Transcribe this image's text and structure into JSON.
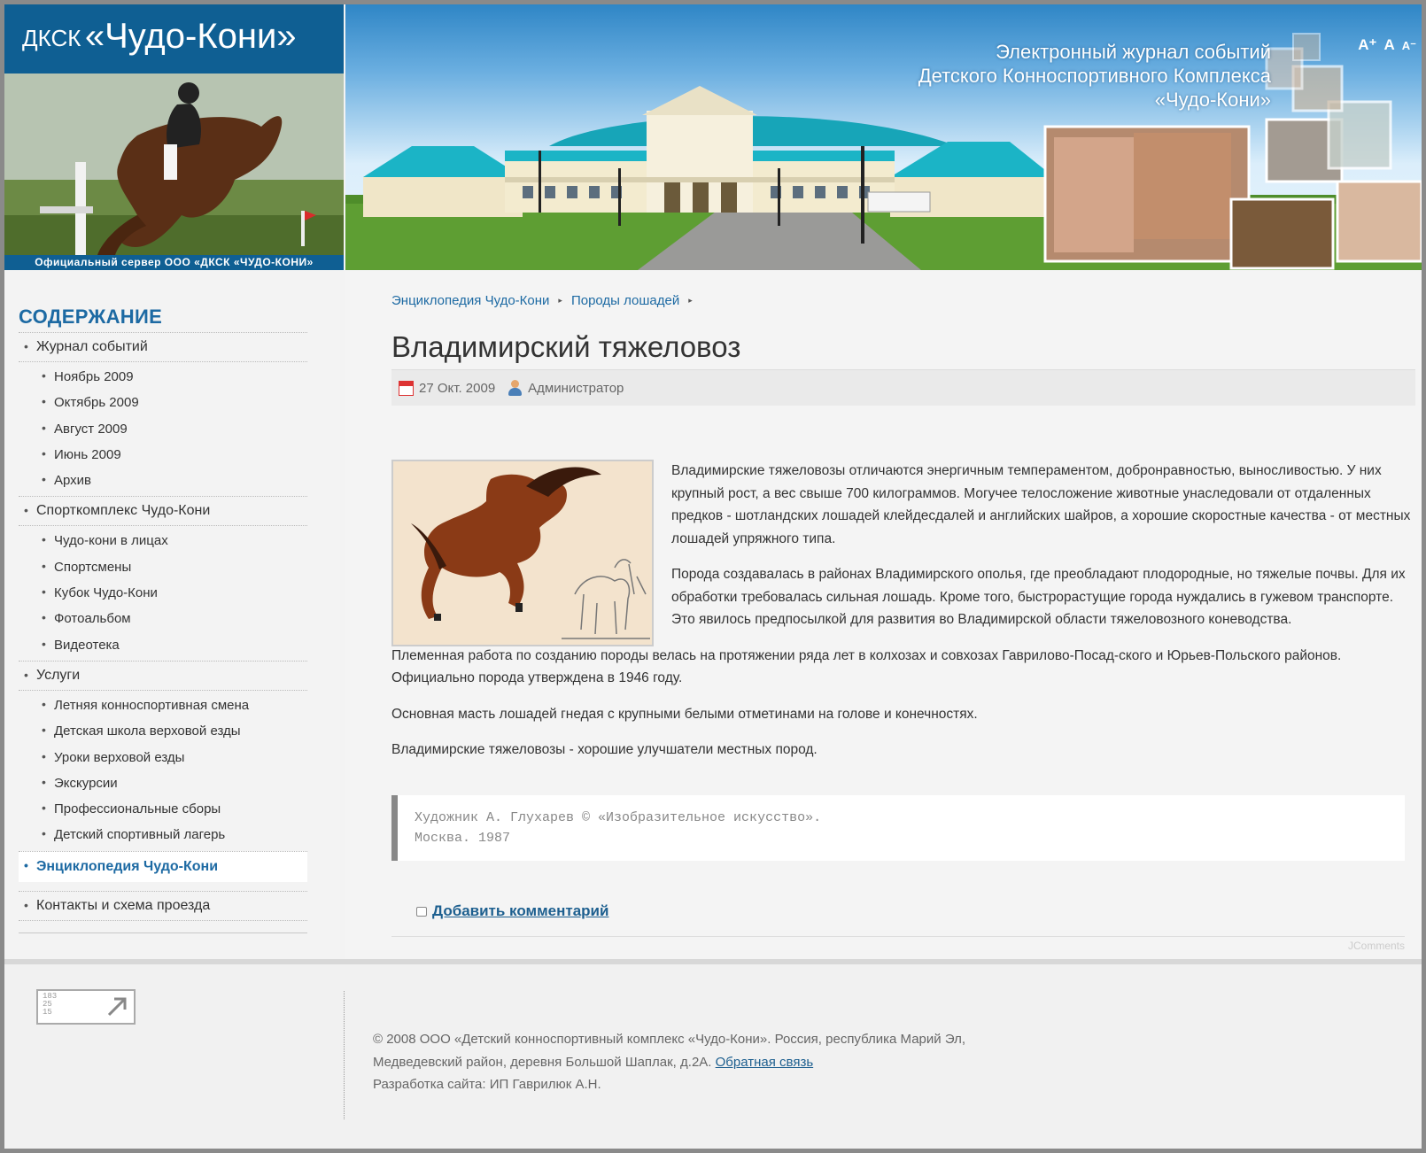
{
  "header": {
    "logo_small": "ДКСК",
    "logo_big": "«Чудо-Кони»",
    "logo_caption": "Официальный сервер ООО «ДКСК «ЧУДО-КОНИ»",
    "banner_title_line1": "Электронный журнал событий",
    "banner_title_line2": "Детского Конноспортивного Комплекса",
    "banner_title_line3": "«Чудо-Кони»",
    "font_controls": {
      "increase": "A⁺",
      "reset": "A",
      "decrease": "A⁻"
    }
  },
  "sidebar": {
    "title": "СОДЕРЖАНИЕ",
    "menu": [
      {
        "label": "Журнал событий",
        "children": [
          "Ноябрь 2009",
          "Октябрь 2009",
          "Август 2009",
          "Июнь 2009",
          "Архив"
        ]
      },
      {
        "label": "Спорткомплекс Чудо-Кони",
        "children": [
          "Чудо-кони в лицах",
          "Спортсмены",
          "Кубок Чудо-Кони",
          "Фотоальбом",
          "Видеотека"
        ]
      },
      {
        "label": "Услуги",
        "children": [
          "Летняя конноспортивная смена",
          "Детская школа верховой езды",
          "Уроки верховой езды",
          "Экскурсии",
          "Профессиональные сборы",
          "Детский спортивный лагерь"
        ]
      },
      {
        "label": "Энциклопедия Чудо-Кони",
        "active": true
      },
      {
        "label": "Контакты и схема проезда"
      }
    ]
  },
  "breadcrumb": [
    "Энциклопедия Чудо-Кони",
    "Породы лошадей"
  ],
  "article": {
    "title": "Владимирский тяжеловоз",
    "date": "27 Окт. 2009",
    "author": "Администратор",
    "paragraphs": [
      "Владимирские тяжеловозы отличаются энергичным темпераментом, добронравностью, выносливостью. У них крупный рост, а вес свыше 700 килограммов. Могучее телосложение животные унаследовали от отдаленных предков - шотландских лошадей клейдесдалей и английских шайров, а хорошие скоростные качества - от местных лошадей упряжного типа.",
      "Порода создавалась в районах Владимирского ополья, где преобладают плодородные, но тяжелые почвы. Для их обработки требовалась сильная лошадь. Кроме того, быстрорастущие города нуждались в гужевом транспорте. Это явилось предпосылкой для развития во Владимирской области тяжеловозного коневодства.",
      "Племенная работа по созданию породы велась на протяжении ряда лет в колхозах и совхозах Гаврилово-Посад-ского и Юрьев-Польского районов. Официально порода утверждена в 1946 году.",
      "Основная масть лошадей гнедая с крупными белыми отметинами на голове и конечностях.",
      "Владимирские тяжеловозы - хорошие улучшатели местных пород."
    ],
    "quote_line1": "Художник А. Глухарев © «Изобразительное искусство».",
    "quote_line2": "Москва. 1987",
    "add_comment": "Добавить комментарий",
    "jcomments": "JComments"
  },
  "footer": {
    "counter_nums": [
      "183",
      "25",
      "15"
    ],
    "line1": "© 2008 ООО «Детский конноспортивный комплекс «Чудо-Кони». Россия, республика Марий Эл,",
    "line2": "Медведевский район, деревня Большой Шаплак, д.2А.",
    "feedback_link": "Обратная связь",
    "line3": "Разработка сайта: ИП Гаврилюк А.Н."
  },
  "colors": {
    "brand_blue": "#0f5f93",
    "link_blue": "#1d6aa3",
    "page_bg": "#f3f3f3"
  }
}
